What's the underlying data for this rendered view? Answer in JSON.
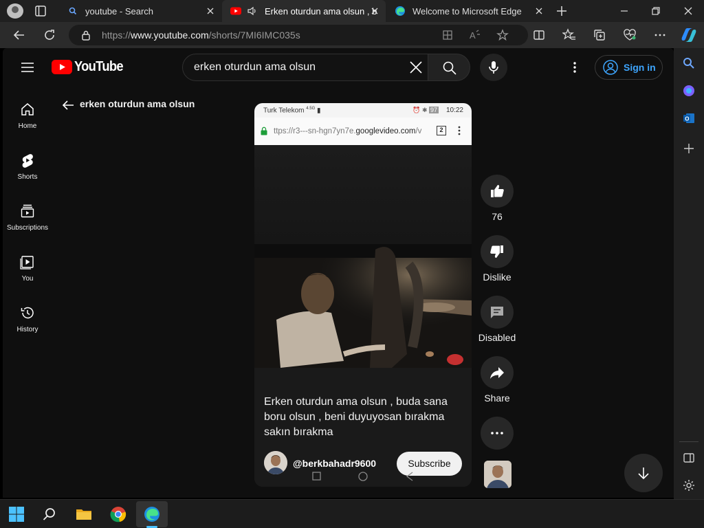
{
  "browser": {
    "tabs": [
      {
        "title": "youtube - Search"
      },
      {
        "title": "Erken oturdun ama olsun , b"
      },
      {
        "title": "Welcome to Microsoft Edge"
      }
    ],
    "url_scheme": "https://",
    "url_host": "www.youtube.com",
    "url_path": "/shorts/7MI6IMC035s"
  },
  "youtube": {
    "logo_text": "YouTube",
    "search_query": "erken oturdun ama olsun",
    "sign_in_label": "Sign in",
    "guide": [
      {
        "label": "Home",
        "icon": "home-icon"
      },
      {
        "label": "Shorts",
        "icon": "shorts-icon"
      },
      {
        "label": "Subscriptions",
        "icon": "subscriptions-icon"
      },
      {
        "label": "You",
        "icon": "you-icon"
      },
      {
        "label": "History",
        "icon": "history-icon"
      }
    ],
    "results_heading": "erken oturdun ama olsun",
    "short": {
      "phone_status": {
        "carrier": "Turk Telekom",
        "signal": "4.5G",
        "battery": "97",
        "time": "10:22"
      },
      "phone_url_prefix": "ttps://r3---sn-hgn7yn7e.",
      "phone_url_host": "googlevideo.com",
      "phone_url_suffix": "/v",
      "phone_tab_count": "2",
      "caption": "Erken oturdun ama olsun , buda sana boru olsun , beni duyuyosan bırakma sakın bırakma",
      "channel": "@berkbahadr9600",
      "subscribe_label": "Subscribe"
    },
    "actions": {
      "like_count": "76",
      "dislike_label": "Dislike",
      "comments_label": "Disabled",
      "share_label": "Share"
    }
  },
  "colors": {
    "yt_red": "#ff0000",
    "link_blue": "#3ea6ff",
    "edge_accent": "#4cc2ff"
  }
}
